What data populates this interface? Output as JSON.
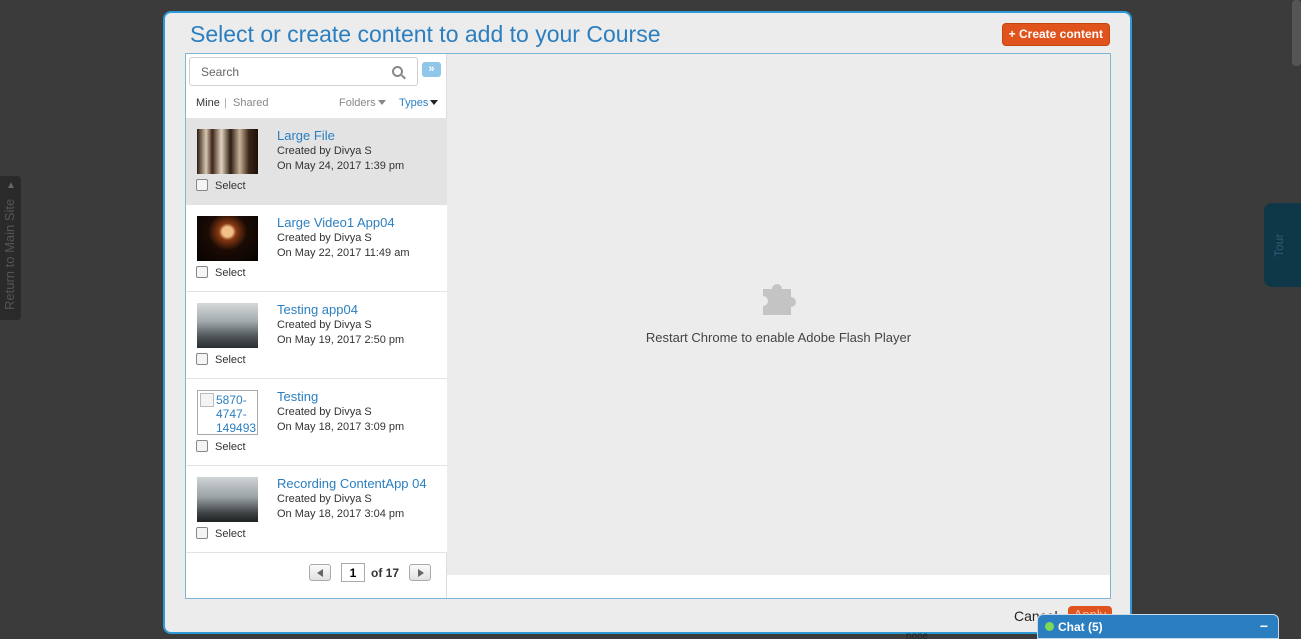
{
  "backdrop": {
    "return_label": "Return to Main Site",
    "tour_label": "Tour",
    "below_text": "none"
  },
  "modal": {
    "title": "Select or create content to add to your Course",
    "create_button": "+ Create content"
  },
  "search": {
    "placeholder": "Search",
    "expand_label": "»"
  },
  "filters": {
    "mine": "Mine",
    "separator": "|",
    "shared": "Shared",
    "folders": "Folders",
    "types": "Types"
  },
  "items": [
    {
      "title": "Large File",
      "created_by": "Created by Divya S",
      "date": "On May 24, 2017 1:39 pm",
      "select": "Select"
    },
    {
      "title": "Large Video1 App04",
      "created_by": "Created by Divya S",
      "date": "On May 22, 2017 11:49 am",
      "select": "Select"
    },
    {
      "title": "Testing app04",
      "created_by": "Created by Divya S",
      "date": "On May 19, 2017 2:50 pm",
      "select": "Select"
    },
    {
      "title": "Testing",
      "created_by": "Created by Divya S",
      "date": "On May 18, 2017 3:09 pm",
      "select": "Select",
      "thumb_alt": "5870-4747-149493"
    },
    {
      "title": "Recording ContentApp 04",
      "created_by": "Created by Divya S",
      "date": "On May 18, 2017 3:04 pm",
      "select": "Select"
    }
  ],
  "pager": {
    "page": "1",
    "of_label": "of 17"
  },
  "preview": {
    "icon": "puzzle-piece-icon",
    "message": "Restart Chrome to enable Adobe Flash Player"
  },
  "footer": {
    "cancel": "Cancel",
    "apply": "Apply"
  },
  "chat": {
    "label": "Chat  (5)",
    "minimize": "−"
  },
  "colors": {
    "accent": "#2b7fc0",
    "create_button": "#e0531c",
    "status_online": "#7ed957"
  }
}
